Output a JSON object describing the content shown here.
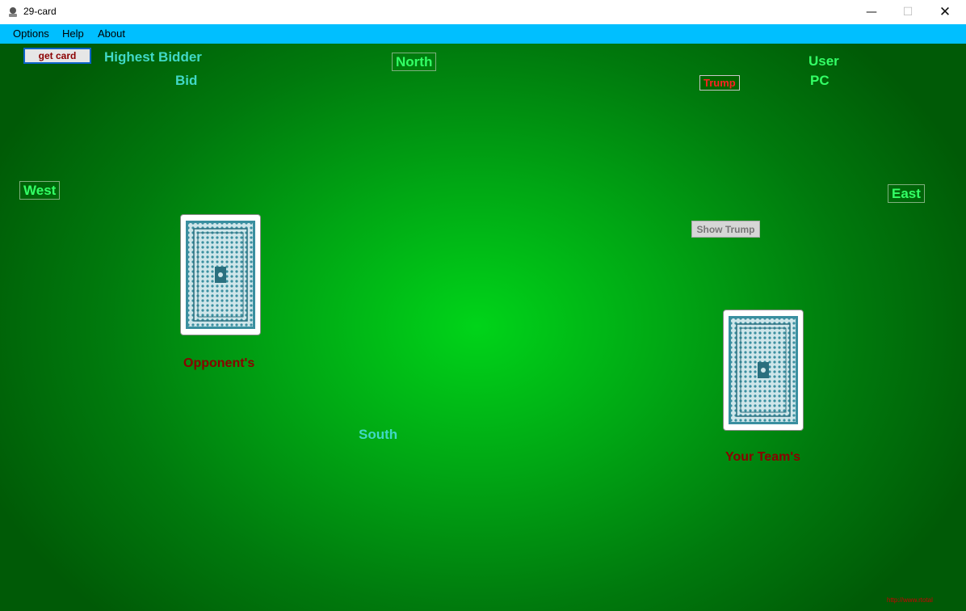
{
  "window": {
    "title": "29-card",
    "minimize_glyph": "—",
    "maximize_glyph": "☐",
    "close_glyph": "✕"
  },
  "menu": {
    "items": [
      "Options",
      "Help",
      "About"
    ]
  },
  "toolbar": {
    "get_card_label": "get card"
  },
  "labels": {
    "highest_bidder": "Highest Bidder",
    "bid": "Bid",
    "north": "North",
    "user": "User",
    "pc": "PC",
    "trump": "Trump",
    "west": "West",
    "east": "East",
    "south": "South",
    "show_trump": "Show Trump"
  },
  "cards": {
    "opponent_label": "Opponent's",
    "team_label": "Your Team's"
  },
  "watermark": "http://www.rtotal",
  "colors": {
    "table_center": "#00d419",
    "table_edge": "#005a06",
    "menubar": "#00bfff",
    "label_cyan": "#41d8c6",
    "label_lime": "#33ff66",
    "team_label": "#8b0000",
    "trump_text": "#ff2222",
    "card_back": "#3a8fa0"
  }
}
